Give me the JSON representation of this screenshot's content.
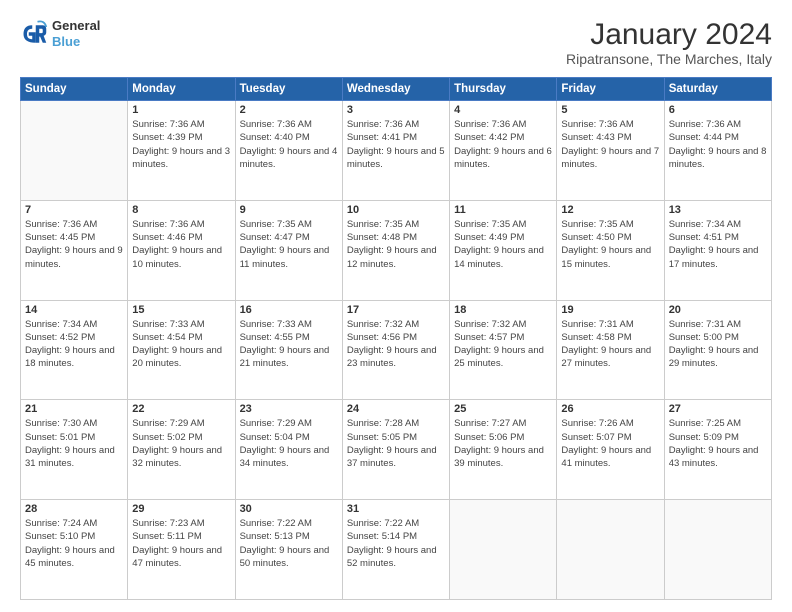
{
  "logo": {
    "line1": "General",
    "line2": "Blue"
  },
  "title": "January 2024",
  "subtitle": "Ripatransone, The Marches, Italy",
  "weekdays": [
    "Sunday",
    "Monday",
    "Tuesday",
    "Wednesday",
    "Thursday",
    "Friday",
    "Saturday"
  ],
  "weeks": [
    [
      {
        "day": "",
        "sunrise": "",
        "sunset": "",
        "daylight": ""
      },
      {
        "day": "1",
        "sunrise": "Sunrise: 7:36 AM",
        "sunset": "Sunset: 4:39 PM",
        "daylight": "Daylight: 9 hours and 3 minutes."
      },
      {
        "day": "2",
        "sunrise": "Sunrise: 7:36 AM",
        "sunset": "Sunset: 4:40 PM",
        "daylight": "Daylight: 9 hours and 4 minutes."
      },
      {
        "day": "3",
        "sunrise": "Sunrise: 7:36 AM",
        "sunset": "Sunset: 4:41 PM",
        "daylight": "Daylight: 9 hours and 5 minutes."
      },
      {
        "day": "4",
        "sunrise": "Sunrise: 7:36 AM",
        "sunset": "Sunset: 4:42 PM",
        "daylight": "Daylight: 9 hours and 6 minutes."
      },
      {
        "day": "5",
        "sunrise": "Sunrise: 7:36 AM",
        "sunset": "Sunset: 4:43 PM",
        "daylight": "Daylight: 9 hours and 7 minutes."
      },
      {
        "day": "6",
        "sunrise": "Sunrise: 7:36 AM",
        "sunset": "Sunset: 4:44 PM",
        "daylight": "Daylight: 9 hours and 8 minutes."
      }
    ],
    [
      {
        "day": "7",
        "sunrise": "Sunrise: 7:36 AM",
        "sunset": "Sunset: 4:45 PM",
        "daylight": "Daylight: 9 hours and 9 minutes."
      },
      {
        "day": "8",
        "sunrise": "Sunrise: 7:36 AM",
        "sunset": "Sunset: 4:46 PM",
        "daylight": "Daylight: 9 hours and 10 minutes."
      },
      {
        "day": "9",
        "sunrise": "Sunrise: 7:35 AM",
        "sunset": "Sunset: 4:47 PM",
        "daylight": "Daylight: 9 hours and 11 minutes."
      },
      {
        "day": "10",
        "sunrise": "Sunrise: 7:35 AM",
        "sunset": "Sunset: 4:48 PM",
        "daylight": "Daylight: 9 hours and 12 minutes."
      },
      {
        "day": "11",
        "sunrise": "Sunrise: 7:35 AM",
        "sunset": "Sunset: 4:49 PM",
        "daylight": "Daylight: 9 hours and 14 minutes."
      },
      {
        "day": "12",
        "sunrise": "Sunrise: 7:35 AM",
        "sunset": "Sunset: 4:50 PM",
        "daylight": "Daylight: 9 hours and 15 minutes."
      },
      {
        "day": "13",
        "sunrise": "Sunrise: 7:34 AM",
        "sunset": "Sunset: 4:51 PM",
        "daylight": "Daylight: 9 hours and 17 minutes."
      }
    ],
    [
      {
        "day": "14",
        "sunrise": "Sunrise: 7:34 AM",
        "sunset": "Sunset: 4:52 PM",
        "daylight": "Daylight: 9 hours and 18 minutes."
      },
      {
        "day": "15",
        "sunrise": "Sunrise: 7:33 AM",
        "sunset": "Sunset: 4:54 PM",
        "daylight": "Daylight: 9 hours and 20 minutes."
      },
      {
        "day": "16",
        "sunrise": "Sunrise: 7:33 AM",
        "sunset": "Sunset: 4:55 PM",
        "daylight": "Daylight: 9 hours and 21 minutes."
      },
      {
        "day": "17",
        "sunrise": "Sunrise: 7:32 AM",
        "sunset": "Sunset: 4:56 PM",
        "daylight": "Daylight: 9 hours and 23 minutes."
      },
      {
        "day": "18",
        "sunrise": "Sunrise: 7:32 AM",
        "sunset": "Sunset: 4:57 PM",
        "daylight": "Daylight: 9 hours and 25 minutes."
      },
      {
        "day": "19",
        "sunrise": "Sunrise: 7:31 AM",
        "sunset": "Sunset: 4:58 PM",
        "daylight": "Daylight: 9 hours and 27 minutes."
      },
      {
        "day": "20",
        "sunrise": "Sunrise: 7:31 AM",
        "sunset": "Sunset: 5:00 PM",
        "daylight": "Daylight: 9 hours and 29 minutes."
      }
    ],
    [
      {
        "day": "21",
        "sunrise": "Sunrise: 7:30 AM",
        "sunset": "Sunset: 5:01 PM",
        "daylight": "Daylight: 9 hours and 31 minutes."
      },
      {
        "day": "22",
        "sunrise": "Sunrise: 7:29 AM",
        "sunset": "Sunset: 5:02 PM",
        "daylight": "Daylight: 9 hours and 32 minutes."
      },
      {
        "day": "23",
        "sunrise": "Sunrise: 7:29 AM",
        "sunset": "Sunset: 5:04 PM",
        "daylight": "Daylight: 9 hours and 34 minutes."
      },
      {
        "day": "24",
        "sunrise": "Sunrise: 7:28 AM",
        "sunset": "Sunset: 5:05 PM",
        "daylight": "Daylight: 9 hours and 37 minutes."
      },
      {
        "day": "25",
        "sunrise": "Sunrise: 7:27 AM",
        "sunset": "Sunset: 5:06 PM",
        "daylight": "Daylight: 9 hours and 39 minutes."
      },
      {
        "day": "26",
        "sunrise": "Sunrise: 7:26 AM",
        "sunset": "Sunset: 5:07 PM",
        "daylight": "Daylight: 9 hours and 41 minutes."
      },
      {
        "day": "27",
        "sunrise": "Sunrise: 7:25 AM",
        "sunset": "Sunset: 5:09 PM",
        "daylight": "Daylight: 9 hours and 43 minutes."
      }
    ],
    [
      {
        "day": "28",
        "sunrise": "Sunrise: 7:24 AM",
        "sunset": "Sunset: 5:10 PM",
        "daylight": "Daylight: 9 hours and 45 minutes."
      },
      {
        "day": "29",
        "sunrise": "Sunrise: 7:23 AM",
        "sunset": "Sunset: 5:11 PM",
        "daylight": "Daylight: 9 hours and 47 minutes."
      },
      {
        "day": "30",
        "sunrise": "Sunrise: 7:22 AM",
        "sunset": "Sunset: 5:13 PM",
        "daylight": "Daylight: 9 hours and 50 minutes."
      },
      {
        "day": "31",
        "sunrise": "Sunrise: 7:22 AM",
        "sunset": "Sunset: 5:14 PM",
        "daylight": "Daylight: 9 hours and 52 minutes."
      },
      {
        "day": "",
        "sunrise": "",
        "sunset": "",
        "daylight": ""
      },
      {
        "day": "",
        "sunrise": "",
        "sunset": "",
        "daylight": ""
      },
      {
        "day": "",
        "sunrise": "",
        "sunset": "",
        "daylight": ""
      }
    ]
  ]
}
